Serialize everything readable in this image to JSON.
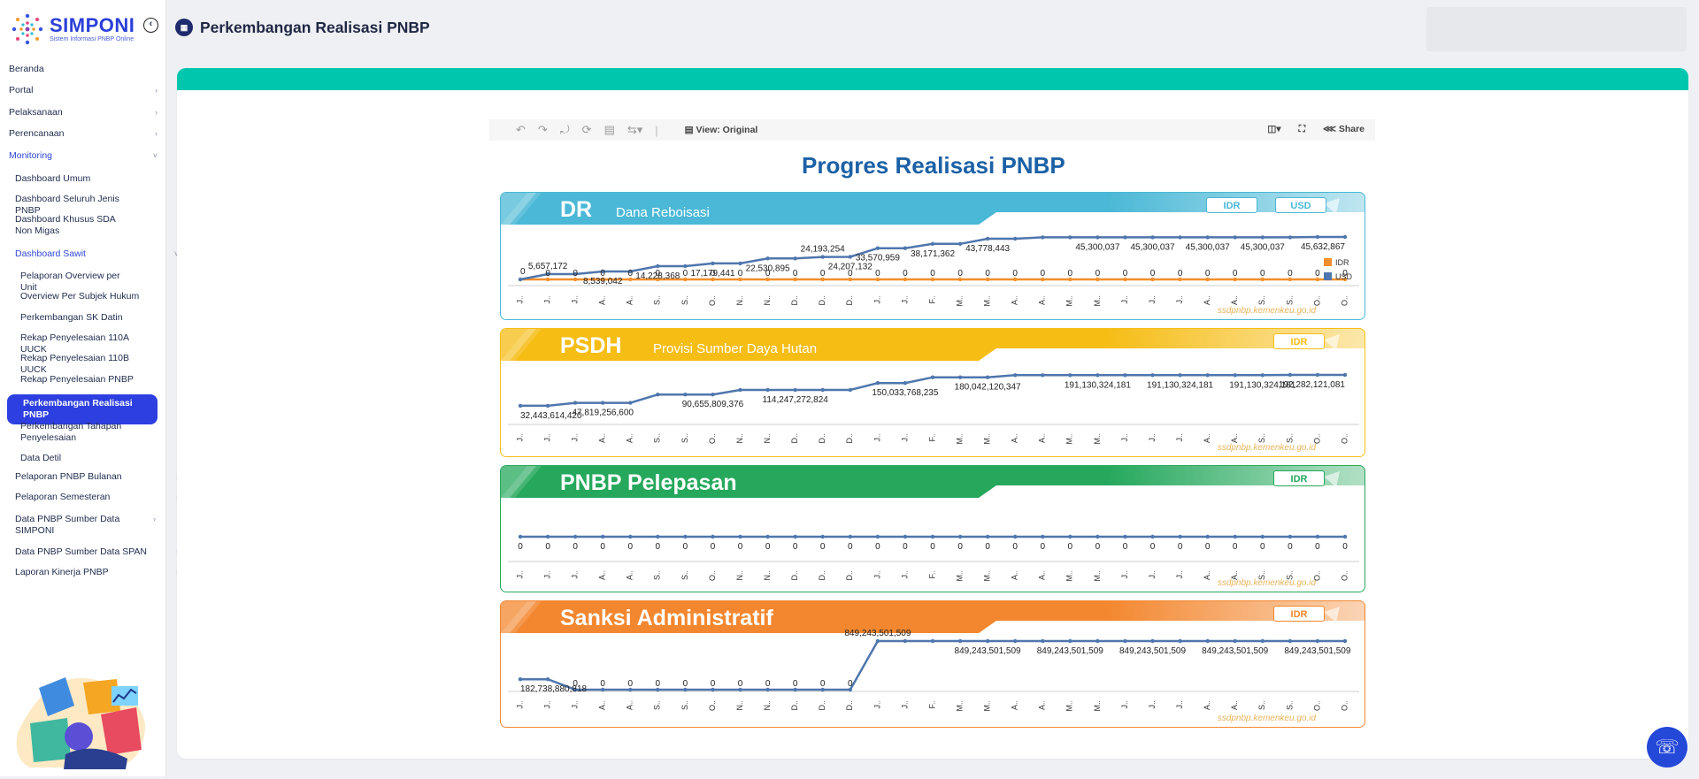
{
  "app": {
    "name": "SIMPONI",
    "tagline": "Sistem Informasi PNBP Online"
  },
  "header": {
    "page_title": "Perkembangan Realisasi PNBP"
  },
  "sidebar": {
    "items": [
      {
        "label": "Beranda",
        "level": 0,
        "chevron": false
      },
      {
        "label": "Portal",
        "level": 0,
        "chevron": true
      },
      {
        "label": "Pelaksanaan",
        "level": 0,
        "chevron": true
      },
      {
        "label": "Perencanaan",
        "level": 0,
        "chevron": true
      },
      {
        "label": "Monitoring",
        "level": 0,
        "chevron": true,
        "active": true,
        "open": true
      },
      {
        "label": "Dashboard Umum",
        "level": 1
      },
      {
        "label": "Dashboard Seluruh Jenis PNBP",
        "level": 1
      },
      {
        "label": "Dashboard Khusus SDA Non Migas",
        "level": 1
      },
      {
        "label": "Dashboard Sawit",
        "level": 1,
        "chevron": true,
        "active": true,
        "open": true
      },
      {
        "label": "Pelaporan Overview per Unit",
        "level": 2
      },
      {
        "label": "Overview Per Subjek Hukum",
        "level": 2
      },
      {
        "label": "Perkembangan SK Datin",
        "level": 2
      },
      {
        "label": "Rekap Penyelesaian 110A UUCK",
        "level": 2
      },
      {
        "label": "Rekap Penyelesaian 110B UUCK",
        "level": 2
      },
      {
        "label": "Rekap Penyelesaian PNBP",
        "level": 2
      },
      {
        "label": "Perkembangan Realisasi PNBP",
        "level": 2,
        "selected": true
      },
      {
        "label": "Perkembangan Tahapan Penyelesaian",
        "level": 2
      },
      {
        "label": "Data Detil",
        "level": 2
      },
      {
        "label": "Pelaporan PNBP Bulanan",
        "level": 1,
        "chevron": true
      },
      {
        "label": "Pelaporan Semesteran",
        "level": 1,
        "chevron": true
      },
      {
        "label": "Data PNBP Sumber Data SIMPONI",
        "level": 1,
        "chevron": true
      },
      {
        "label": "Data PNBP Sumber Data SPAN",
        "level": 1,
        "chevron": true
      },
      {
        "label": "Laporan Kinerja PNBP",
        "level": 1,
        "chevron": true
      }
    ]
  },
  "toolbar": {
    "view": "View: Original",
    "share": "Share",
    "icons": [
      "undo-icon",
      "redo-icon",
      "revert-icon",
      "refresh-icon",
      "pause-icon",
      "track-changes-icon",
      "view-icon",
      "device-icon",
      "fullscreen-icon",
      "share-icon"
    ]
  },
  "dashboard": {
    "title": "Progres Realisasi PNBP",
    "watermark": "ssdpnbp.kemenkeu.go.id"
  },
  "colors": {
    "dr": "#4ab8d6",
    "psdh": "#f6bd15",
    "pelepasan": "#25a85c",
    "sanksi": "#f3872f",
    "line": "#4f76ad",
    "idr": "#f28e2b",
    "brand": "#2b3fd8",
    "accent": "#00c6ad"
  },
  "chart_data": [
    {
      "type": "line",
      "title": "DR",
      "subtitle": "Dana Reboisasi",
      "buttons": [
        "IDR",
        "USD"
      ],
      "categories": [
        "J..",
        "J..",
        "J..",
        "A..",
        "A..",
        "S..",
        "S..",
        "O..",
        "N..",
        "N..",
        "D..",
        "D..",
        "D..",
        "J..",
        "J..",
        "F..",
        "M..",
        "M..",
        "A..",
        "A..",
        "M..",
        "M..",
        "J..",
        "J..",
        "J..",
        "A..",
        "A..",
        "S..",
        "S..",
        "O..",
        "O.."
      ],
      "series": [
        {
          "name": "IDR",
          "color": "#f28e2b",
          "values": [
            0,
            0,
            0,
            0,
            0,
            0,
            0,
            0,
            0,
            0,
            0,
            0,
            0,
            0,
            0,
            0,
            0,
            0,
            0,
            0,
            0,
            0,
            0,
            0,
            0,
            0,
            0,
            0,
            0,
            0,
            0
          ]
        },
        {
          "name": "USD",
          "color": "#4f76ad",
          "values": [
            0,
            5657172,
            5657172,
            8539042,
            8539042,
            14228368,
            14228368,
            17179441,
            17179441,
            22530895,
            22530895,
            24193254,
            24207132,
            33570959,
            33570959,
            38171362,
            38171362,
            43778443,
            43778443,
            45300037,
            45300037,
            45300037,
            45300037,
            45300037,
            45300037,
            45300037,
            45300037,
            45300037,
            45300037,
            45632867,
            45632867
          ]
        }
      ],
      "labels": [
        {
          "i": 0,
          "s": 0,
          "text": "0",
          "pos": "above"
        },
        {
          "i": 1,
          "s": 1,
          "text": "5,657,172",
          "pos": "above"
        },
        {
          "i": 3,
          "s": 1,
          "text": "8,539,042",
          "pos": "below"
        },
        {
          "i": 5,
          "s": 1,
          "text": "14,228,368",
          "pos": "below"
        },
        {
          "i": 7,
          "s": 1,
          "text": "17,179,441",
          "pos": "below"
        },
        {
          "i": 9,
          "s": 1,
          "text": "22,530,895",
          "pos": "below"
        },
        {
          "i": 11,
          "s": 1,
          "text": "24,193,254",
          "pos": "above"
        },
        {
          "i": 12,
          "s": 1,
          "text": "24,207,132",
          "pos": "below"
        },
        {
          "i": 13,
          "s": 1,
          "text": "33,570,959",
          "pos": "below"
        },
        {
          "i": 15,
          "s": 1,
          "text": "38,171,362",
          "pos": "below"
        },
        {
          "i": 17,
          "s": 1,
          "text": "43,778,443",
          "pos": "below"
        },
        {
          "i": 21,
          "s": 1,
          "text": "45,300,037",
          "pos": "below"
        },
        {
          "i": 23,
          "s": 1,
          "text": "45,300,037",
          "pos": "below"
        },
        {
          "i": 25,
          "s": 1,
          "text": "45,300,037",
          "pos": "below"
        },
        {
          "i": 27,
          "s": 1,
          "text": "45,300,037",
          "pos": "below"
        },
        {
          "i": 30,
          "s": 1,
          "text": "45,632,867",
          "pos": "below"
        }
      ],
      "zero_row": true,
      "legend": [
        "IDR",
        "USD"
      ]
    },
    {
      "type": "line",
      "title": "PSDH",
      "subtitle": "Provisi Sumber Daya Hutan",
      "buttons": [
        "IDR"
      ],
      "categories": [
        "J..",
        "J..",
        "J..",
        "A..",
        "A..",
        "S..",
        "S..",
        "O..",
        "N..",
        "N..",
        "D..",
        "D..",
        "D..",
        "J..",
        "J..",
        "F..",
        "M..",
        "M..",
        "A..",
        "A..",
        "M..",
        "M..",
        "J..",
        "J..",
        "J..",
        "A..",
        "A..",
        "S..",
        "S..",
        "O..",
        "O.."
      ],
      "series": [
        {
          "name": "IDR",
          "color": "#4f76ad",
          "values": [
            32443614420,
            32443614420,
            47819256600,
            47819256600,
            47819256600,
            90655809376,
            90655809376,
            90655809376,
            114247272824,
            114247272824,
            114247272824,
            114247272824,
            114247272824,
            150033768235,
            150033768235,
            180042120347,
            180042120347,
            180042120347,
            191130324181,
            191130324181,
            191130324181,
            191130324181,
            191130324181,
            191130324181,
            191130324181,
            191130324181,
            191130324181,
            191130324181,
            192282121081,
            192282121081,
            192282121081
          ]
        }
      ],
      "labels": [
        {
          "i": 0,
          "s": 0,
          "text": "32,443,614,420",
          "pos": "below"
        },
        {
          "i": 3,
          "s": 0,
          "text": "47,819,256,600",
          "pos": "below"
        },
        {
          "i": 7,
          "s": 0,
          "text": "90,655,809,376",
          "pos": "below"
        },
        {
          "i": 10,
          "s": 0,
          "text": "114,247,272,824",
          "pos": "below"
        },
        {
          "i": 14,
          "s": 0,
          "text": "150,033,768,235",
          "pos": "below"
        },
        {
          "i": 17,
          "s": 0,
          "text": "180,042,120,347",
          "pos": "below"
        },
        {
          "i": 21,
          "s": 0,
          "text": "191,130,324,181",
          "pos": "below"
        },
        {
          "i": 24,
          "s": 0,
          "text": "191,130,324,181",
          "pos": "below"
        },
        {
          "i": 27,
          "s": 0,
          "text": "191,130,324,181",
          "pos": "below"
        },
        {
          "i": 30,
          "s": 0,
          "text": "192,282,121,081",
          "pos": "below"
        }
      ],
      "zero_row": false
    },
    {
      "type": "line",
      "title": "PNBP Pelepasan",
      "subtitle": "",
      "buttons": [
        "IDR"
      ],
      "categories": [
        "J..",
        "J..",
        "J..",
        "A..",
        "A..",
        "S..",
        "S..",
        "O..",
        "N..",
        "N..",
        "D..",
        "D..",
        "D..",
        "J..",
        "J..",
        "F..",
        "M..",
        "M..",
        "A..",
        "A..",
        "M..",
        "M..",
        "J..",
        "J..",
        "J..",
        "A..",
        "A..",
        "S..",
        "S..",
        "O..",
        "O.."
      ],
      "series": [
        {
          "name": "IDR",
          "color": "#4f76ad",
          "values": [
            0,
            0,
            0,
            0,
            0,
            0,
            0,
            0,
            0,
            0,
            0,
            0,
            0,
            0,
            0,
            0,
            0,
            0,
            0,
            0,
            0,
            0,
            0,
            0,
            0,
            0,
            0,
            0,
            0,
            0,
            0
          ]
        }
      ],
      "labels": [],
      "zero_row": true
    },
    {
      "type": "line",
      "title": "Sanksi Administratif",
      "subtitle": "",
      "buttons": [
        "IDR"
      ],
      "categories": [
        "J..",
        "J..",
        "J..",
        "A..",
        "A..",
        "S..",
        "S..",
        "O..",
        "N..",
        "N..",
        "D..",
        "D..",
        "D..",
        "J..",
        "J..",
        "F..",
        "M..",
        "M..",
        "A..",
        "A..",
        "M..",
        "M..",
        "J..",
        "J..",
        "J..",
        "A..",
        "A..",
        "S..",
        "S..",
        "O..",
        "O.."
      ],
      "series": [
        {
          "name": "IDR",
          "color": "#4f76ad",
          "values": [
            182738880818,
            182738880818,
            0,
            0,
            0,
            0,
            0,
            0,
            0,
            0,
            0,
            0,
            0,
            849243501509,
            849243501509,
            849243501509,
            849243501509,
            849243501509,
            849243501509,
            849243501509,
            849243501509,
            849243501509,
            849243501509,
            849243501509,
            849243501509,
            849243501509,
            849243501509,
            849243501509,
            849243501509,
            849243501509,
            849243501509
          ]
        }
      ],
      "labels": [
        {
          "i": 0,
          "s": 0,
          "text": "182,738,880,818",
          "pos": "below"
        },
        {
          "i": 13,
          "s": 0,
          "text": "849,243,501,509",
          "pos": "above"
        },
        {
          "i": 17,
          "s": 0,
          "text": "849,243,501,509",
          "pos": "below"
        },
        {
          "i": 20,
          "s": 0,
          "text": "849,243,501,509",
          "pos": "below"
        },
        {
          "i": 23,
          "s": 0,
          "text": "849,243,501,509",
          "pos": "below"
        },
        {
          "i": 26,
          "s": 0,
          "text": "849,243,501,509",
          "pos": "below"
        },
        {
          "i": 29,
          "s": 0,
          "text": "849,243,501,509",
          "pos": "below"
        }
      ],
      "zero_labels": [
        2,
        3,
        4,
        5,
        6,
        7,
        8,
        9,
        10,
        11,
        12
      ],
      "zero_row": false
    }
  ]
}
